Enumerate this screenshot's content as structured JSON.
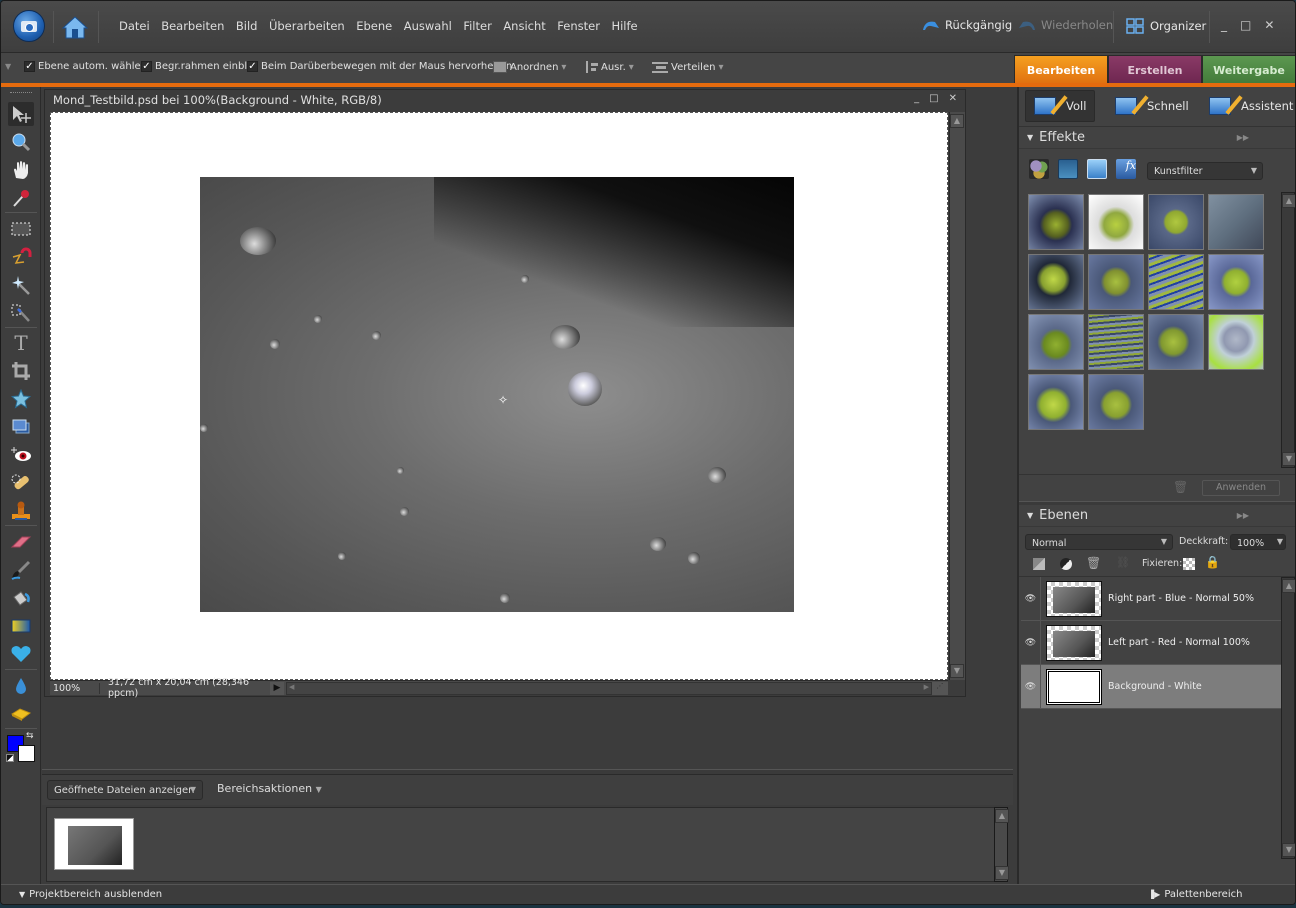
{
  "app": {
    "menu": [
      "Datei",
      "Bearbeiten",
      "Bild",
      "Überarbeiten",
      "Ebene",
      "Auswahl",
      "Filter",
      "Ansicht",
      "Fenster",
      "Hilfe"
    ],
    "undo_label": "Rückgängig",
    "redo_label": "Wiederholen",
    "organizer_label": "Organizer",
    "window_controls": {
      "minimize": "_",
      "maximize": "□",
      "close": "✕"
    }
  },
  "options": {
    "auto_select_layer": {
      "label": "Ebene autom. wählen",
      "checked": true
    },
    "show_bounding_box": {
      "label": "Begr.rahmen einbl.",
      "checked": true
    },
    "highlight_on_hover": {
      "label": "Beim Darüberbewegen mit der Maus hervorheben",
      "checked": true
    },
    "arrange_label": "Anordnen",
    "align_label": "Ausr.",
    "distribute_label": "Verteilen",
    "check_glyph": "✓",
    "dropdown_glyph": "▾"
  },
  "mode_tabs": [
    {
      "label": "Bearbeiten",
      "color": "#e8801a",
      "active": true
    },
    {
      "label": "Erstellen",
      "color": "#7a2e5a",
      "active": false
    },
    {
      "label": "Weitergabe",
      "color": "#4e8a44",
      "active": false
    }
  ],
  "tools": [
    {
      "name": "move",
      "glyph": "✥"
    },
    {
      "name": "zoom",
      "glyph": "🔍"
    },
    {
      "name": "hand",
      "glyph": "✋"
    },
    {
      "name": "eyedropper",
      "glyph": "✎"
    },
    {
      "name": "rectangular-marquee",
      "glyph": "⬚"
    },
    {
      "name": "magnetic-lasso",
      "glyph": "⌒"
    },
    {
      "name": "magic-wand",
      "glyph": "✴"
    },
    {
      "name": "selection-brush",
      "glyph": "⸬"
    },
    {
      "name": "type",
      "glyph": "T"
    },
    {
      "name": "crop",
      "glyph": "⌗"
    },
    {
      "name": "cookie-cutter",
      "glyph": "☆"
    },
    {
      "name": "straighten",
      "glyph": "▭"
    },
    {
      "name": "red-eye",
      "glyph": "◉"
    },
    {
      "name": "healing-brush",
      "glyph": "✚"
    },
    {
      "name": "clone-stamp",
      "glyph": "♜"
    },
    {
      "name": "eraser",
      "glyph": "▰"
    },
    {
      "name": "brush",
      "glyph": "🖌"
    },
    {
      "name": "paint-bucket",
      "glyph": "⛾"
    },
    {
      "name": "gradient",
      "glyph": "▤"
    },
    {
      "name": "custom-shape",
      "glyph": "♥"
    },
    {
      "name": "blur",
      "glyph": "💧"
    },
    {
      "name": "sponge",
      "glyph": "⬬"
    }
  ],
  "colors": {
    "foreground": "#0000ff",
    "background": "#ffffff",
    "swap_glyph": "⇆"
  },
  "document": {
    "title": "Mond_Testbild.psd bei 100%(Background - White, RGB/8)",
    "zoom": "100%",
    "dimensions": "31,72 cm x 20,04 cm (28,346 ppcm)"
  },
  "project_bin": {
    "show_select": "Geöffnete Dateien anzeigen",
    "actions_label": "Bereichsaktionen",
    "hide_label": "Projektbereich ausblenden"
  },
  "palette_bin_label": "Palettenbereich",
  "edit_modes": [
    {
      "label": "Voll",
      "active": true
    },
    {
      "label": "Schnell",
      "active": false
    },
    {
      "label": "Assistent",
      "active": false
    }
  ],
  "effects": {
    "title": "Effekte",
    "category": "Kunstfilter",
    "thumbnail_count": 14,
    "apply_label": "Anwenden"
  },
  "layers": {
    "title": "Ebenen",
    "blend_mode": "Normal",
    "opacity_label": "Deckkraft:",
    "opacity": "100%",
    "lock_label": "Fixieren:",
    "items": [
      {
        "name": "Right part - Blue - Normal 50%",
        "visible": true,
        "selected": false,
        "transparent": true
      },
      {
        "name": "Left part - Red - Normal 100%",
        "visible": true,
        "selected": false,
        "transparent": true
      },
      {
        "name": "Background - White",
        "visible": true,
        "selected": true,
        "transparent": false
      }
    ]
  }
}
